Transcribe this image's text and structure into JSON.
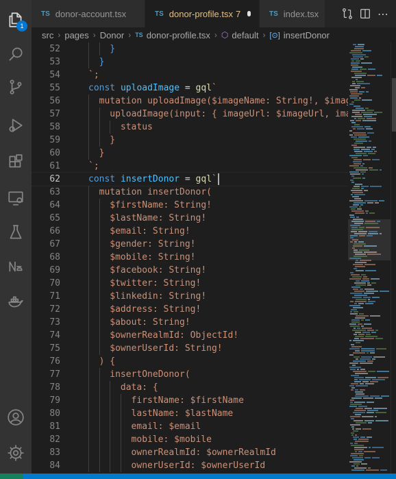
{
  "tabs": [
    {
      "icon": "TS",
      "label": "donor-account.tsx",
      "active": false
    },
    {
      "icon": "TS",
      "label": "donor-profile.tsx",
      "count": "7",
      "active": true
    },
    {
      "icon": "TS",
      "label": "index.tsx",
      "active": false
    }
  ],
  "breadcrumb": {
    "parts": [
      "src",
      "pages",
      "Donor"
    ],
    "file": "donor-profile.tsx",
    "symbol1": "default",
    "symbol2": "insertDonor"
  },
  "activity": {
    "badge": "1"
  },
  "editor": {
    "current_line": 62,
    "lines": [
      {
        "n": "52",
        "indent": 2,
        "tokens": [
          {
            "t": "}",
            "c": "kw"
          }
        ]
      },
      {
        "n": "53",
        "indent": 1,
        "tokens": [
          {
            "t": "}",
            "c": "kw"
          }
        ]
      },
      {
        "n": "54",
        "indent": 0,
        "tokens": [
          {
            "t": "`;",
            "c": "str"
          }
        ]
      },
      {
        "n": "55",
        "indent": 0,
        "tokens": [
          {
            "t": "const ",
            "c": "kw"
          },
          {
            "t": "uploadImage",
            "c": "var"
          },
          {
            "t": " = ",
            "c": "pl"
          },
          {
            "t": "gql",
            "c": "fn"
          },
          {
            "t": "`",
            "c": "str"
          }
        ]
      },
      {
        "n": "56",
        "indent": 1,
        "tokens": [
          {
            "t": "mutation uploadImage($imageName: String!, $imageUrl",
            "c": "str"
          }
        ]
      },
      {
        "n": "57",
        "indent": 2,
        "tokens": [
          {
            "t": "uploadImage(input: { imageUrl: $imageUrl, ima",
            "c": "str"
          }
        ]
      },
      {
        "n": "58",
        "indent": 3,
        "tokens": [
          {
            "t": "status",
            "c": "str"
          }
        ]
      },
      {
        "n": "59",
        "indent": 2,
        "tokens": [
          {
            "t": "}",
            "c": "str"
          }
        ]
      },
      {
        "n": "60",
        "indent": 1,
        "tokens": [
          {
            "t": "}",
            "c": "str"
          }
        ]
      },
      {
        "n": "61",
        "indent": 0,
        "tokens": [
          {
            "t": "`;",
            "c": "str"
          }
        ]
      },
      {
        "n": "62",
        "indent": 0,
        "tokens": [
          {
            "t": "const ",
            "c": "kw"
          },
          {
            "t": "insertDonor",
            "c": "var"
          },
          {
            "t": " = ",
            "c": "pl"
          },
          {
            "t": "gql",
            "c": "fn"
          },
          {
            "t": "`",
            "c": "str"
          }
        ],
        "cursor": true
      },
      {
        "n": "63",
        "indent": 1,
        "tokens": [
          {
            "t": "mutation insertDonor(",
            "c": "str"
          }
        ]
      },
      {
        "n": "64",
        "indent": 2,
        "tokens": [
          {
            "t": "$firstName: String!",
            "c": "str"
          }
        ]
      },
      {
        "n": "65",
        "indent": 2,
        "tokens": [
          {
            "t": "$lastName: String!",
            "c": "str"
          }
        ]
      },
      {
        "n": "66",
        "indent": 2,
        "tokens": [
          {
            "t": "$email: String!",
            "c": "str"
          }
        ]
      },
      {
        "n": "67",
        "indent": 2,
        "tokens": [
          {
            "t": "$gender: String!",
            "c": "str"
          }
        ]
      },
      {
        "n": "68",
        "indent": 2,
        "tokens": [
          {
            "t": "$mobile: String!",
            "c": "str"
          }
        ]
      },
      {
        "n": "69",
        "indent": 2,
        "tokens": [
          {
            "t": "$facebook: String!",
            "c": "str"
          }
        ]
      },
      {
        "n": "70",
        "indent": 2,
        "tokens": [
          {
            "t": "$twitter: String!",
            "c": "str"
          }
        ]
      },
      {
        "n": "71",
        "indent": 2,
        "tokens": [
          {
            "t": "$linkedin: String!",
            "c": "str"
          }
        ]
      },
      {
        "n": "72",
        "indent": 2,
        "tokens": [
          {
            "t": "$address: String!",
            "c": "str"
          }
        ]
      },
      {
        "n": "73",
        "indent": 2,
        "tokens": [
          {
            "t": "$about: String!",
            "c": "str"
          }
        ]
      },
      {
        "n": "74",
        "indent": 2,
        "tokens": [
          {
            "t": "$ownerRealmId: ObjectId!",
            "c": "str"
          }
        ]
      },
      {
        "n": "75",
        "indent": 2,
        "tokens": [
          {
            "t": "$ownerUserId: String!",
            "c": "str"
          }
        ]
      },
      {
        "n": "76",
        "indent": 1,
        "tokens": [
          {
            "t": ") {",
            "c": "str"
          }
        ]
      },
      {
        "n": "77",
        "indent": 2,
        "tokens": [
          {
            "t": "insertOneDonor(",
            "c": "str"
          }
        ]
      },
      {
        "n": "78",
        "indent": 3,
        "tokens": [
          {
            "t": "data: {",
            "c": "str"
          }
        ]
      },
      {
        "n": "79",
        "indent": 4,
        "tokens": [
          {
            "t": "firstName: $firstName",
            "c": "str"
          }
        ]
      },
      {
        "n": "80",
        "indent": 4,
        "tokens": [
          {
            "t": "lastName: $lastName",
            "c": "str"
          }
        ]
      },
      {
        "n": "81",
        "indent": 4,
        "tokens": [
          {
            "t": "email: $email",
            "c": "str"
          }
        ]
      },
      {
        "n": "82",
        "indent": 4,
        "tokens": [
          {
            "t": "mobile: $mobile",
            "c": "str"
          }
        ]
      },
      {
        "n": "83",
        "indent": 4,
        "tokens": [
          {
            "t": "ownerRealmId: $ownerRealmId",
            "c": "str"
          }
        ]
      },
      {
        "n": "84",
        "indent": 4,
        "tokens": [
          {
            "t": "ownerUserId: $ownerUserId",
            "c": "str"
          }
        ]
      }
    ]
  },
  "colors": {
    "keyword": "#569cd6",
    "variable": "#4fc1ff",
    "function": "#dcdcaa",
    "string": "#ce9178",
    "modified_tab": "#e2c08d",
    "status_bar": "#007acc"
  },
  "icons": {
    "activity": [
      "files-icon",
      "search-icon",
      "source-control-icon",
      "run-debug-icon",
      "extensions-icon",
      "remote-explorer-icon",
      "testing-icon",
      "notebook-icon",
      "docker-icon",
      "account-icon",
      "settings-gear-icon"
    ],
    "tab_actions": [
      "compare-changes-icon",
      "split-editor-icon",
      "more-actions-icon"
    ]
  }
}
